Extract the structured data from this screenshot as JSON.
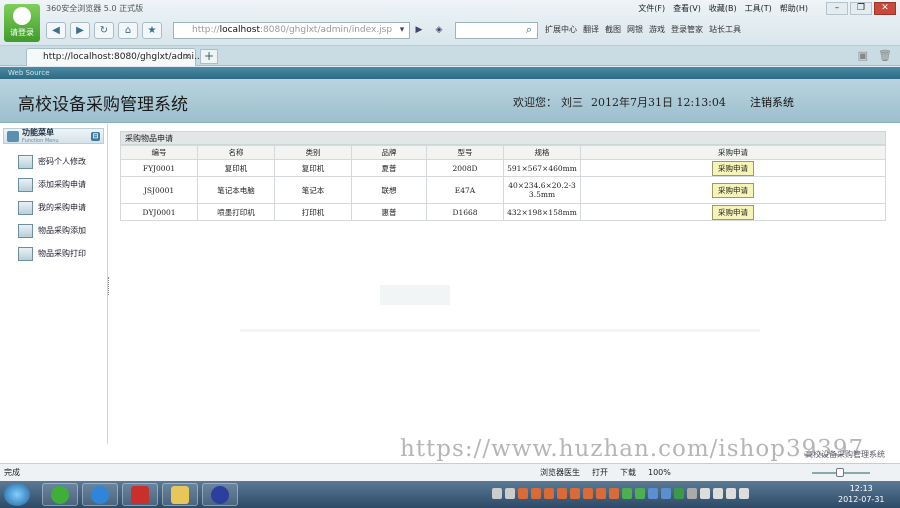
{
  "browser": {
    "app_title": "360安全浏览器 5.0 正式版",
    "logo_label": "请登录",
    "menu": [
      "文件(F)",
      "查看(V)",
      "收藏(B)",
      "工具(T)",
      "帮助(H)"
    ],
    "address_prefix": "http://",
    "address_host": "localhost",
    "address_rest": ":8080/ghglxt/admin/index.jsp",
    "tools": [
      "扩展中心",
      "翻译",
      "截图",
      "网银",
      "游戏",
      "登录管家",
      "站长工具"
    ],
    "tab_title": "http://localhost:8080/ghglxt/admi...",
    "frame_caption": "Web Source"
  },
  "header": {
    "system_title": "高校设备采购管理系统",
    "welcome_label": "欢迎您：",
    "user_name": "刘三",
    "datetime": "2012年7月31日 12:13:04",
    "logout_label": "注销系统"
  },
  "sidebar": {
    "title": "功能菜单",
    "subtitle": "Function Menu",
    "toggle": "⊟",
    "items": [
      {
        "label": "密码个人修改"
      },
      {
        "label": "添加采购申请"
      },
      {
        "label": "我的采购申请"
      },
      {
        "label": "物品采购添加"
      },
      {
        "label": "物品采购打印"
      }
    ]
  },
  "panel": {
    "title": "采购物品申请",
    "columns": [
      "编号",
      "名称",
      "类别",
      "品牌",
      "型号",
      "规格",
      "采购申请"
    ],
    "rows": [
      {
        "id": "FYJ0001",
        "name": "复印机",
        "category": "复印机",
        "brand": "夏普",
        "model": "2008D",
        "spec": "591×567×460mm",
        "action": "采购申请"
      },
      {
        "id": "JSJ0001",
        "name": "笔记本电脑",
        "category": "笔记本",
        "brand": "联想",
        "model": "E47A",
        "spec": "40×234.6×20.2-33.5mm",
        "action": "采购申请"
      },
      {
        "id": "DYJ0001",
        "name": "喷墨打印机",
        "category": "打印机",
        "brand": "惠普",
        "model": "D1668",
        "spec": "432×198×158mm",
        "action": "采购申请"
      }
    ]
  },
  "footer": {
    "watermark": "https://www.huzhan.com/ishop39397",
    "watermark_sub": "高校设备采购管理系统"
  },
  "status": {
    "left": "完成",
    "items": [
      "浏览器医生",
      "打开",
      "下载"
    ],
    "zoom": "100%"
  },
  "taskbar": {
    "time": "12:13",
    "date": "2012-07-31"
  },
  "colors": {
    "header_bg": "#a9c9d6",
    "frame_bar": "#2d6a83",
    "apply_button": "#f6f4b8"
  }
}
